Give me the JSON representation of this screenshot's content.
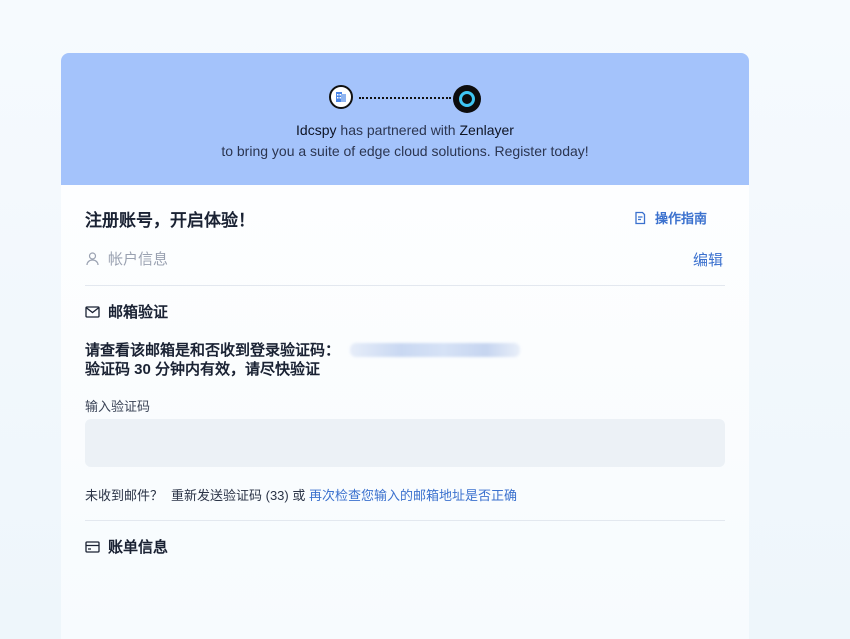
{
  "banner": {
    "partner_a": "Idcspy",
    "partner_text": "has partnered with",
    "partner_b": "Zenlayer",
    "tagline": "to bring you a suite of edge cloud solutions. Register today!",
    "accent_color": "#a4c3fb"
  },
  "form": {
    "title": "注册账号，开启体验！",
    "guide_label": "操作指南",
    "account_section": {
      "label": "帐户信息",
      "edit_label": "编辑"
    },
    "email_section": {
      "label": "邮箱验证",
      "check_prompt": "请查看该邮箱是和否收到登录验证码：",
      "validity_note": "验证码 30 分钟内有效，请尽快验证",
      "code_label": "输入验证码",
      "code_value": "",
      "not_received": "未收到邮件？",
      "resend_label": "重新发送验证码 (33)",
      "or_text": "或",
      "recheck_link": "再次检查您输入的邮箱地址是否正确"
    },
    "billing_section": {
      "label": "账单信息"
    }
  },
  "icons": {
    "guide": "document-icon",
    "account": "user-icon",
    "email": "mail-icon",
    "billing": "credit-card-icon"
  },
  "colors": {
    "link": "#3b71ce",
    "input_bg": "#ecf1f6"
  }
}
